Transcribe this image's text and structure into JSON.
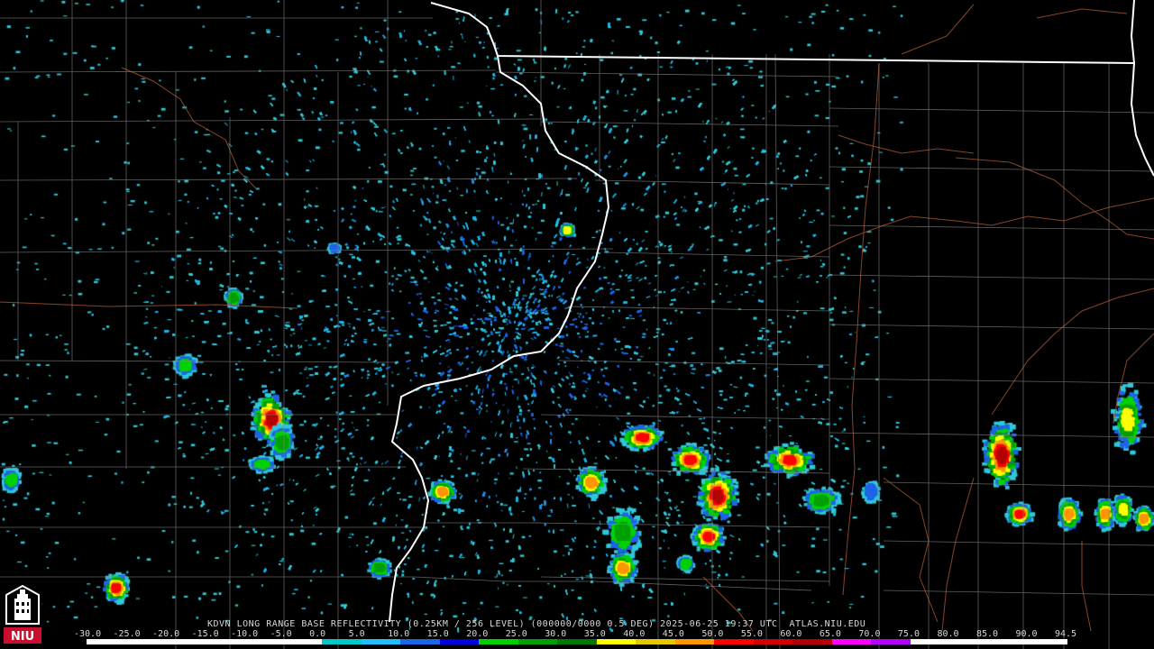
{
  "product": {
    "station": "KDVN",
    "caption": "KDVN LONG RANGE BASE REFLECTIVITY (0.25KM / 256 LEVEL) (000000/0000 0.5 DEG) 2025-06-25 19:37 UTC  ATLAS.NIU.EDU",
    "datetime_utc": "2025-06-25 19:37 UTC",
    "elevation": "0.5 DEG",
    "source": "ATLAS.NIU.EDU"
  },
  "logo": {
    "text": "NIU"
  },
  "colorbar": {
    "ticks": [
      "-30.0",
      "-25.0",
      "-20.0",
      "-15.0",
      "-10.0",
      "-5.0",
      "0.0",
      "5.0",
      "10.0",
      "15.0",
      "20.0",
      "25.0",
      "30.0",
      "35.0",
      "40.0",
      "45.0",
      "50.0",
      "55.0",
      "60.0",
      "65.0",
      "70.0",
      "75.0",
      "80.0",
      "85.0",
      "90.0",
      "94.5"
    ],
    "colors": [
      "#ffffff",
      "#ffffff",
      "#ffffff",
      "#ffffff",
      "#ffffff",
      "#ffffff",
      "#00c8c8",
      "#1ebeff",
      "#1e64e6",
      "#0000dc",
      "#00d200",
      "#00a000",
      "#007800",
      "#ffff00",
      "#e6c800",
      "#ff9600",
      "#ff0000",
      "#d20000",
      "#b40000",
      "#ff00ff",
      "#b400ff",
      "#ffffff",
      "#ffffff",
      "#ffffff",
      "#ffffff"
    ]
  },
  "map_features": {
    "radar_site": "KDVN",
    "boundaries": [
      "state-lines",
      "county-lines",
      "rivers"
    ]
  },
  "colors": {
    "background": "#000000",
    "state_lines": "#ffffff",
    "county_lines": "#8a8a8a",
    "rivers": "#a0522d"
  }
}
